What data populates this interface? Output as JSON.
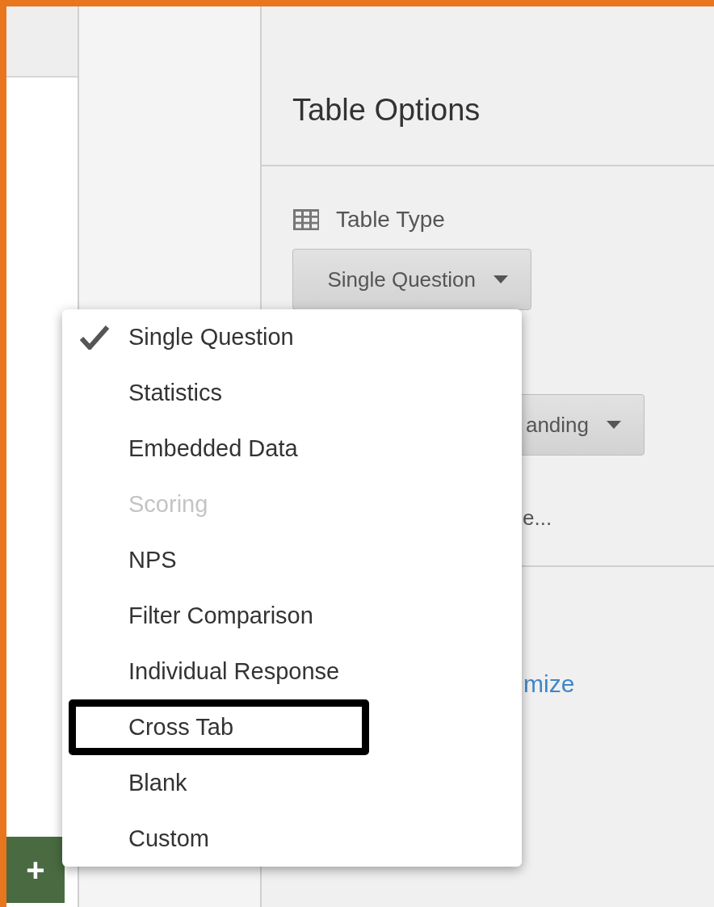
{
  "panel": {
    "title": "Table Options",
    "section_label": "Table Type",
    "table_type_button": "Single Question",
    "second_button": "anding",
    "partial_text": "e...",
    "link_text": "mize"
  },
  "add_button": {
    "label": "+"
  },
  "menu": {
    "items": [
      {
        "label": "Single Question",
        "selected": true,
        "disabled": false,
        "highlighted": false
      },
      {
        "label": "Statistics",
        "selected": false,
        "disabled": false,
        "highlighted": false
      },
      {
        "label": "Embedded Data",
        "selected": false,
        "disabled": false,
        "highlighted": false
      },
      {
        "label": "Scoring",
        "selected": false,
        "disabled": true,
        "highlighted": false
      },
      {
        "label": "NPS",
        "selected": false,
        "disabled": false,
        "highlighted": false
      },
      {
        "label": "Filter Comparison",
        "selected": false,
        "disabled": false,
        "highlighted": false
      },
      {
        "label": "Individual Response",
        "selected": false,
        "disabled": false,
        "highlighted": false
      },
      {
        "label": "Cross Tab",
        "selected": false,
        "disabled": false,
        "highlighted": true
      },
      {
        "label": "Blank",
        "selected": false,
        "disabled": false,
        "highlighted": false
      },
      {
        "label": "Custom",
        "selected": false,
        "disabled": false,
        "highlighted": false
      }
    ]
  }
}
